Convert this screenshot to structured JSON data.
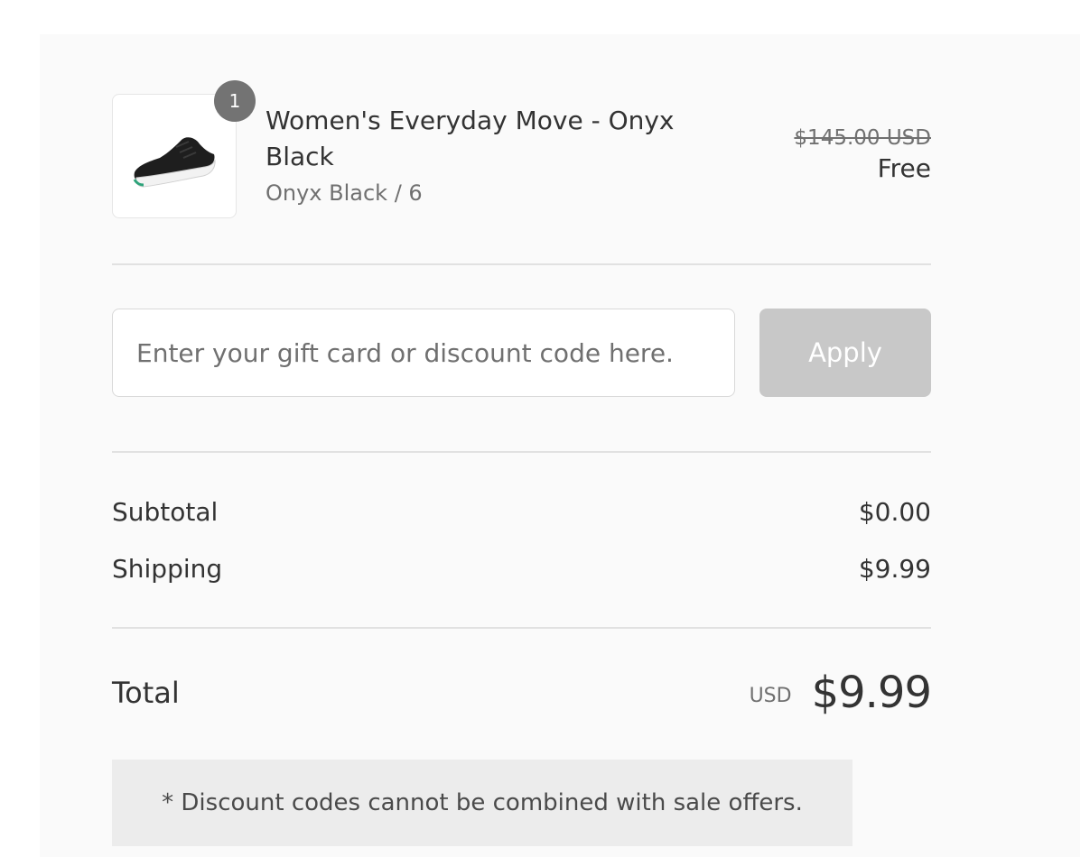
{
  "cart": {
    "item": {
      "quantity": "1",
      "name": "Women's Everyday Move - Onyx Black",
      "variant": "Onyx Black / 6",
      "original_price": "$145.00 USD",
      "price": "Free",
      "image_icon": "sneaker-icon"
    }
  },
  "discount": {
    "placeholder": "Enter your gift card or discount code here.",
    "value": "",
    "apply_label": "Apply"
  },
  "summary": {
    "subtotal_label": "Subtotal",
    "subtotal_value": "$0.00",
    "shipping_label": "Shipping",
    "shipping_value": "$9.99",
    "total_label": "Total",
    "total_currency": "USD",
    "total_value": "$9.99"
  },
  "notice": {
    "text": "* Discount codes cannot be combined with sale offers."
  },
  "colors": {
    "panel_background": "#fafafa",
    "apply_disabled": "#c8c8c8",
    "badge": "#737373",
    "notice_background": "#ececec"
  }
}
